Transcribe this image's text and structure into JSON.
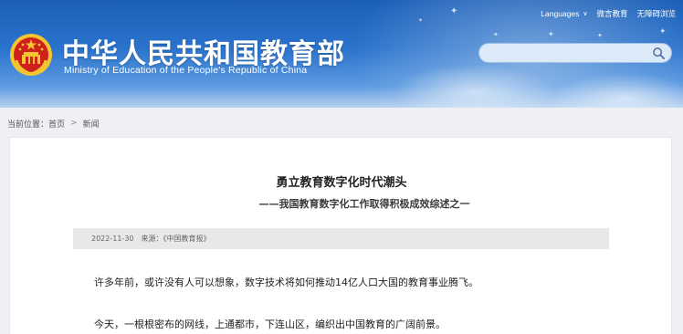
{
  "header": {
    "title_cn": "中华人民共和国教育部",
    "title_en": "Ministry of Education of the People's Republic of China",
    "links": {
      "languages": "Languages",
      "wechat": "微言教育",
      "accessibility": "无障碍浏览"
    },
    "search": {
      "value": "",
      "placeholder": ""
    },
    "colors": {
      "header_blue": "#1b5fb8",
      "emblem_red": "#d0201b",
      "emblem_gold": "#f4c531"
    },
    "icons": {
      "emblem": "national-emblem-icon",
      "search": "search-icon",
      "dropdown": "chevron-down-icon"
    }
  },
  "breadcrumb": {
    "prefix": "当前位置：",
    "home": "首页",
    "separator": ">",
    "current": "新闻"
  },
  "article": {
    "title": "勇立教育数字化时代潮头",
    "subtitle": "——我国教育数字化工作取得积极成效综述之一",
    "date": "2022-11-30",
    "source": "来源：《中国教育报》",
    "paragraphs": [
      "许多年前，或许没有人可以想象，数字技术将如何推动14亿人口大国的教育事业腾飞。",
      "今天，一根根密布的网线，上通都市，下连山区，编织出中国教育的广阔前景。"
    ]
  }
}
